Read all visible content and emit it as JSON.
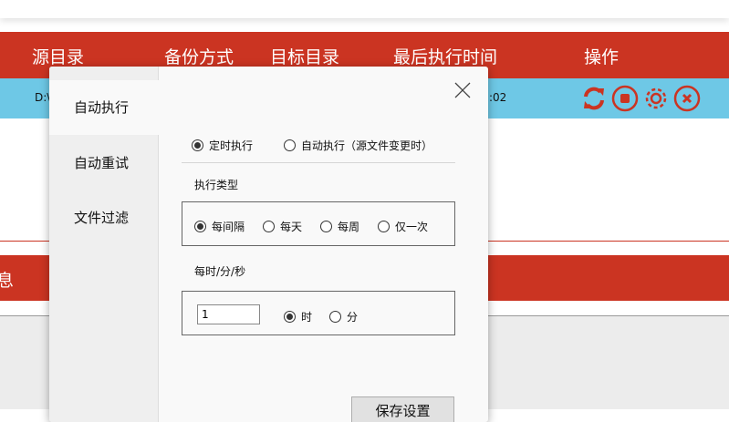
{
  "table": {
    "headers": [
      "源目录",
      "备份方式",
      "目标目录",
      "最后执行时间",
      "操作"
    ],
    "row": {
      "source": "D:\\",
      "time": ":02"
    }
  },
  "bottom_panel": {
    "title": "息"
  },
  "dialog": {
    "tabs": [
      "自动执行",
      "自动重试",
      "文件过滤"
    ],
    "mode_options": [
      "定时执行",
      "自动执行（源文件变更时）"
    ],
    "exec_type_label": "执行类型",
    "exec_types": [
      "每间隔",
      "每天",
      "每周",
      "仅一次"
    ],
    "interval_label": "每时/分/秒",
    "interval_value": "1",
    "units": [
      "时",
      "分"
    ],
    "save_button": "保存设置"
  },
  "colors": {
    "header": "#cb3422",
    "row": "#6ec8e6"
  }
}
